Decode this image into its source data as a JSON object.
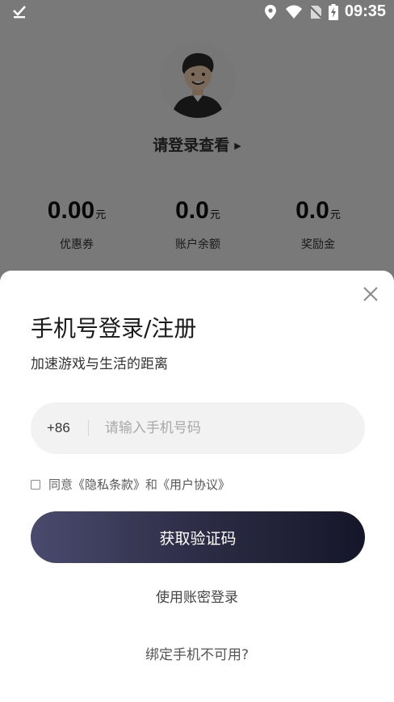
{
  "status_bar": {
    "time": "09:35",
    "icons": [
      "download-done-icon",
      "location-icon",
      "wifi-icon",
      "no-sim-icon",
      "battery-charging-icon"
    ]
  },
  "profile": {
    "login_prompt": "请登录查看",
    "stats": [
      {
        "value": "0.00",
        "unit": "元",
        "label": "优惠券"
      },
      {
        "value": "0.0",
        "unit": "元",
        "label": "账户余额"
      },
      {
        "value": "0.0",
        "unit": "元",
        "label": "奖励金"
      }
    ]
  },
  "login_sheet": {
    "title": "手机号登录/注册",
    "subtitle": "加速游戏与生活的距离",
    "country_code": "+86",
    "phone_placeholder": "请输入手机号码",
    "phone_value": "",
    "agree_prefix": "同意",
    "privacy_link": "《隐私条款》",
    "agree_and": "和",
    "user_agreement_link": "《用户协议》",
    "get_code_button": "获取验证码",
    "password_login": "使用账密登录",
    "phone_unavailable": "绑定手机不可用?"
  },
  "colors": {
    "button_gradient_start": "#4a4a6e",
    "button_gradient_end": "#16162a",
    "overlay": "rgba(0,0,0,0.5)"
  }
}
